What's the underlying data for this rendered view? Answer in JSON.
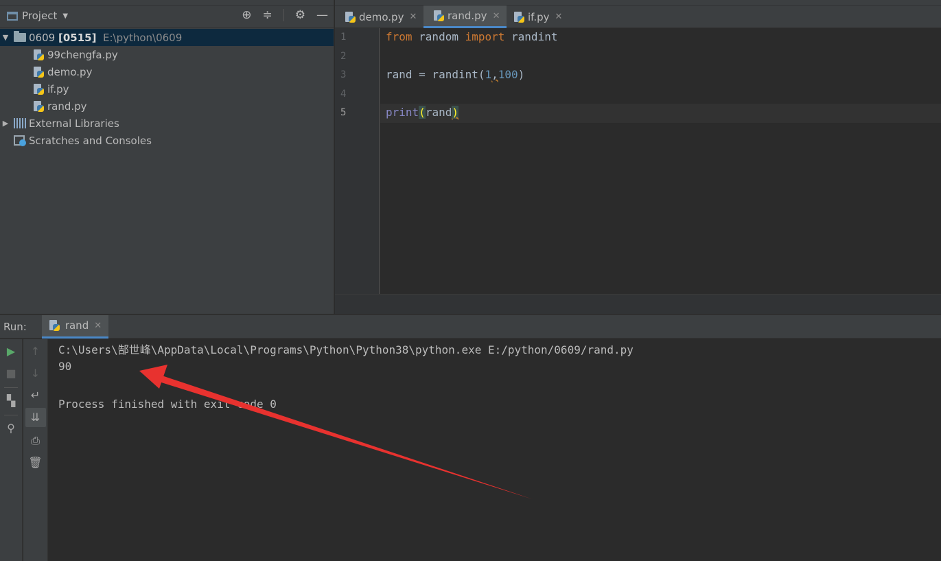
{
  "project_panel": {
    "title": "Project",
    "tools": [
      "⊕",
      "≑",
      "⚙",
      "—"
    ],
    "tree": {
      "root_name": "0609",
      "root_module": "[0515]",
      "root_path": "E:\\python\\0609",
      "files": [
        "99chengfa.py",
        "demo.py",
        "if.py",
        "rand.py"
      ],
      "external_libraries": "External Libraries",
      "scratches": "Scratches and Consoles"
    }
  },
  "editor": {
    "tabs": [
      {
        "label": "demo.py",
        "active": false
      },
      {
        "label": "rand.py",
        "active": true
      },
      {
        "label": "if.py",
        "active": false
      }
    ],
    "line_numbers": [
      "1",
      "2",
      "3",
      "4",
      "5"
    ],
    "code": {
      "l1_kw1": "from",
      "l1_mod": " random ",
      "l1_kw2": "import",
      "l1_name": " randint",
      "l3_a": "rand = randint(",
      "l3_n1": "1",
      "l3_comma": ",",
      "l3_n2": "100",
      "l3_b": ")",
      "l5_fn": "print",
      "l5_open": "(",
      "l5_arg": "rand",
      "l5_close": ")"
    }
  },
  "run_panel": {
    "label": "Run:",
    "tab_label": "rand",
    "console": [
      "C:\\Users\\郜世峰\\AppData\\Local\\Programs\\Python\\Python38\\python.exe E:/python/0609/rand.py",
      "90",
      "",
      "Process finished with exit code 0"
    ]
  },
  "colors": {
    "accent": "#4a88c7",
    "annotation_arrow": "#e8322f"
  }
}
